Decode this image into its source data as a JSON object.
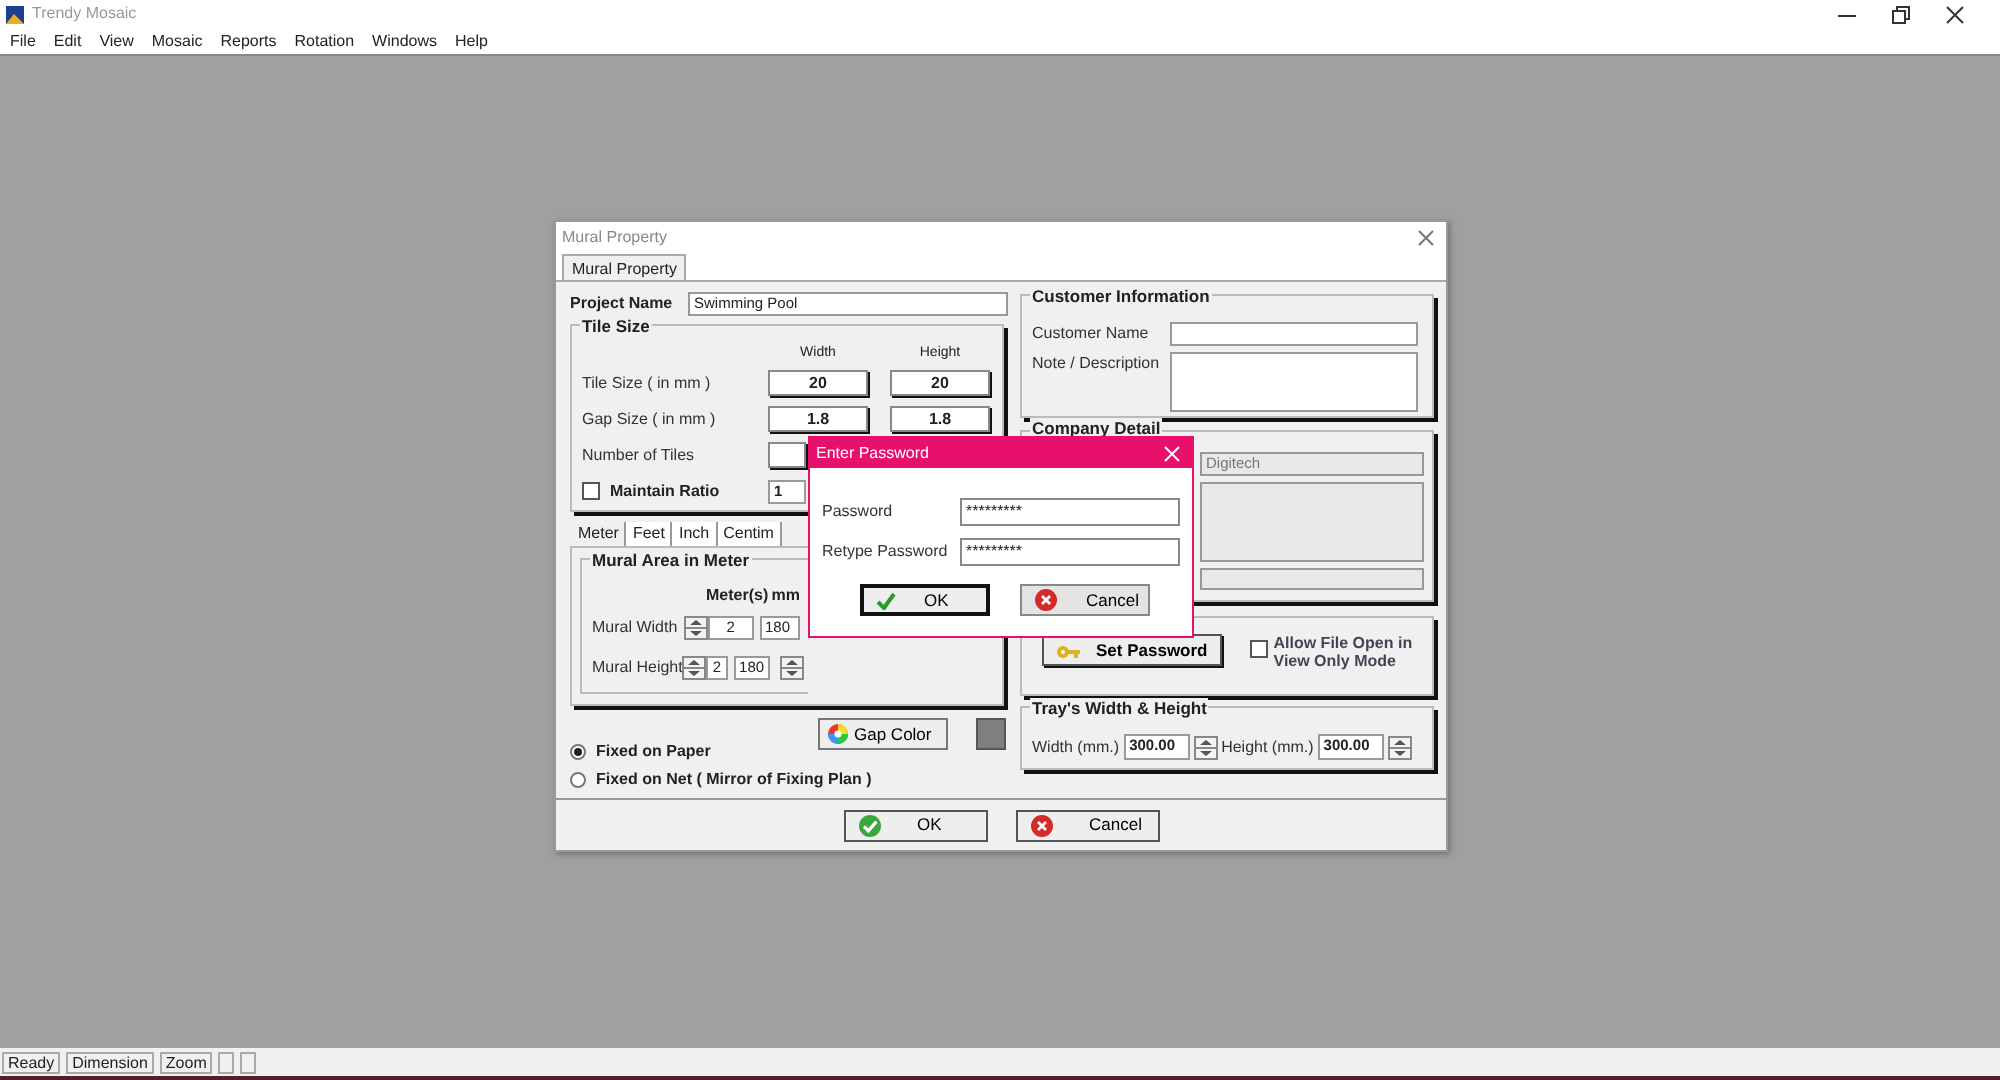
{
  "app": {
    "title": "Trendy Mosaic"
  },
  "menu": [
    "File",
    "Edit",
    "View",
    "Mosaic",
    "Reports",
    "Rotation",
    "Windows",
    "Help"
  ],
  "mural_dialog": {
    "title": "Mural Property",
    "tabs": [
      {
        "label": "Mural Property",
        "selected": true
      }
    ],
    "project_name": {
      "label": "Project Name",
      "value": "Swimming Pool"
    },
    "tile_size": {
      "title": "Tile Size",
      "columns": [
        "Width",
        "Height"
      ],
      "rows": [
        {
          "label": "Tile Size ( in mm )",
          "values": [
            "20",
            "20"
          ]
        },
        {
          "label": "Gap Size ( in mm )",
          "values": [
            "1.8",
            "1.8"
          ]
        },
        {
          "label": "Number of Tiles"
        }
      ],
      "maintain_ratio": {
        "label": "Maintain Ratio",
        "checked": false,
        "value": "1"
      }
    },
    "unit_tabs": [
      {
        "label": "Meter",
        "selected": true
      },
      {
        "label": "Feet",
        "selected": false
      },
      {
        "label": "Inch",
        "selected": false
      },
      {
        "label": "Centim",
        "selected": false
      }
    ],
    "mural_area": {
      "title": "Mural Area in Meter",
      "columns": [
        "Meter(s)",
        "mm"
      ],
      "rows": [
        {
          "label": "Mural Width",
          "meters": "2",
          "mm": "180",
          "mm_spinner": false
        },
        {
          "label": "Mural Height",
          "meters": "2",
          "mm": "180",
          "mm_spinner": true
        }
      ]
    },
    "gap_color": {
      "label": "Gap Color",
      "color": "#7f7f7f"
    },
    "placement": [
      {
        "label": "Fixed on Paper",
        "selected": true
      },
      {
        "label": "Fixed on Net ( Mirror of Fixing Plan )",
        "selected": false
      }
    ],
    "customer": {
      "title": "Customer Information",
      "fields": [
        {
          "label": "Customer Name",
          "kind": "line"
        },
        {
          "label": "Note / Description",
          "kind": "multiline"
        }
      ]
    },
    "company": {
      "title": "Company Detail",
      "name": "Digitech"
    },
    "security": {
      "button": "Set Password",
      "option": {
        "label": "Allow File Open in View Only Mode",
        "checked": false
      }
    },
    "tray": {
      "title": "Tray's Width & Height",
      "fields": [
        {
          "label": "Width (mm.)",
          "value": "300.00"
        },
        {
          "label": "Height (mm.)",
          "value": "300.00"
        }
      ]
    },
    "buttons": [
      {
        "label": "OK",
        "kind": "ok"
      },
      {
        "label": "Cancel",
        "kind": "cancel"
      }
    ]
  },
  "password_dialog": {
    "title": "Enter Password",
    "fields": [
      {
        "label": "Password",
        "value": "*********"
      },
      {
        "label": "Retype Password",
        "value": "*********"
      }
    ],
    "buttons": [
      {
        "label": "OK",
        "kind": "ok",
        "focused": true
      },
      {
        "label": "Cancel",
        "kind": "cancel",
        "focused": false
      }
    ]
  },
  "status_bar": [
    "Ready",
    "Dimension",
    "Zoom"
  ]
}
